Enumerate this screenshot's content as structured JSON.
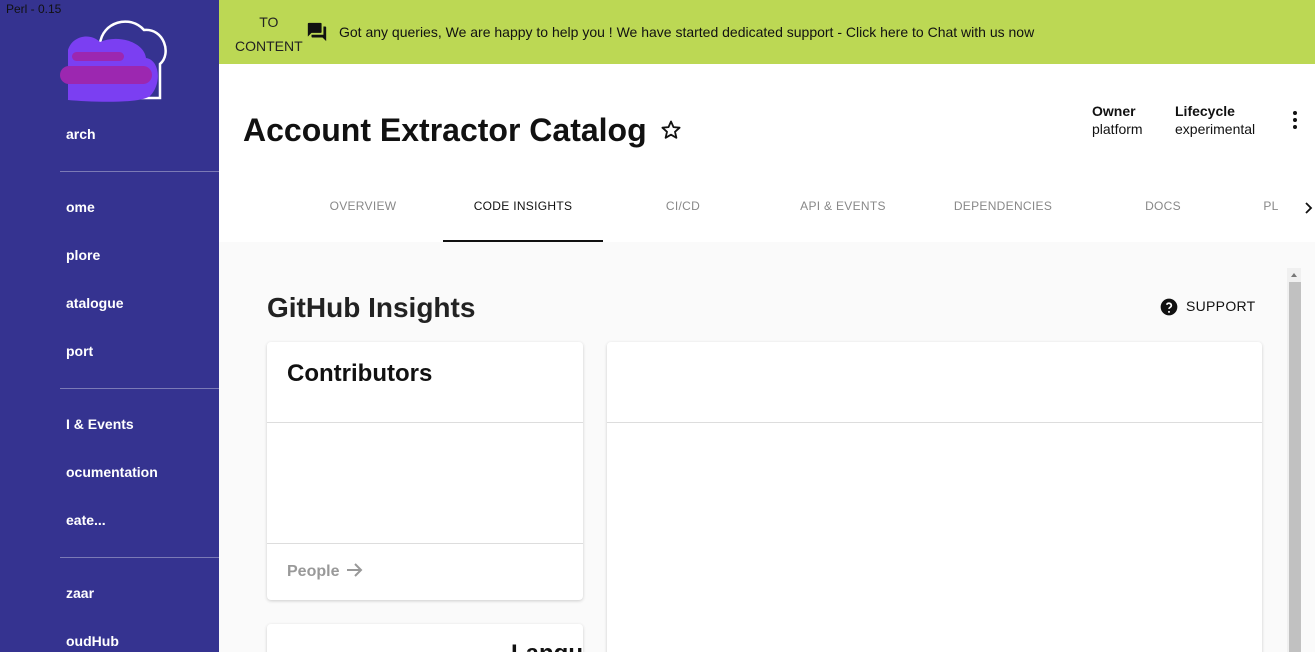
{
  "perf": "Perl - 0.15",
  "sidebar": {
    "items": [
      {
        "label": "arch"
      },
      {
        "label": "ome"
      },
      {
        "label": "plore"
      },
      {
        "label": "atalogue"
      },
      {
        "label": "port"
      },
      {
        "label": "I & Events"
      },
      {
        "label": "ocumentation"
      },
      {
        "label": "eate..."
      },
      {
        "label": "zaar"
      },
      {
        "label": "oudHub"
      }
    ]
  },
  "banner": {
    "skip_line1": "TO",
    "skip_line2": "CONTENT",
    "message": "Got any queries, We are happy to help you ! We have started dedicated support - Click here to Chat with us now",
    "bg_color": "#bcd854"
  },
  "header": {
    "title": "Account Extractor Catalog",
    "owner_label": "Owner",
    "owner_value": "platform",
    "lifecycle_label": "Lifecycle",
    "lifecycle_value": "experimental"
  },
  "tabs": [
    {
      "label": "OVERVIEW"
    },
    {
      "label": "CODE INSIGHTS",
      "active": true
    },
    {
      "label": "CI/CD"
    },
    {
      "label": "API & EVENTS"
    },
    {
      "label": "DEPENDENCIES"
    },
    {
      "label": "DOCS"
    },
    {
      "label": "PL"
    }
  ],
  "main": {
    "section_title": "GitHub Insights",
    "support_label": "SUPPORT",
    "contributors_title": "Contributors",
    "people_link": "People",
    "next_card_peek": "Langu"
  },
  "colors": {
    "sidebar": "#353390",
    "logo": "#7b3ff2"
  }
}
